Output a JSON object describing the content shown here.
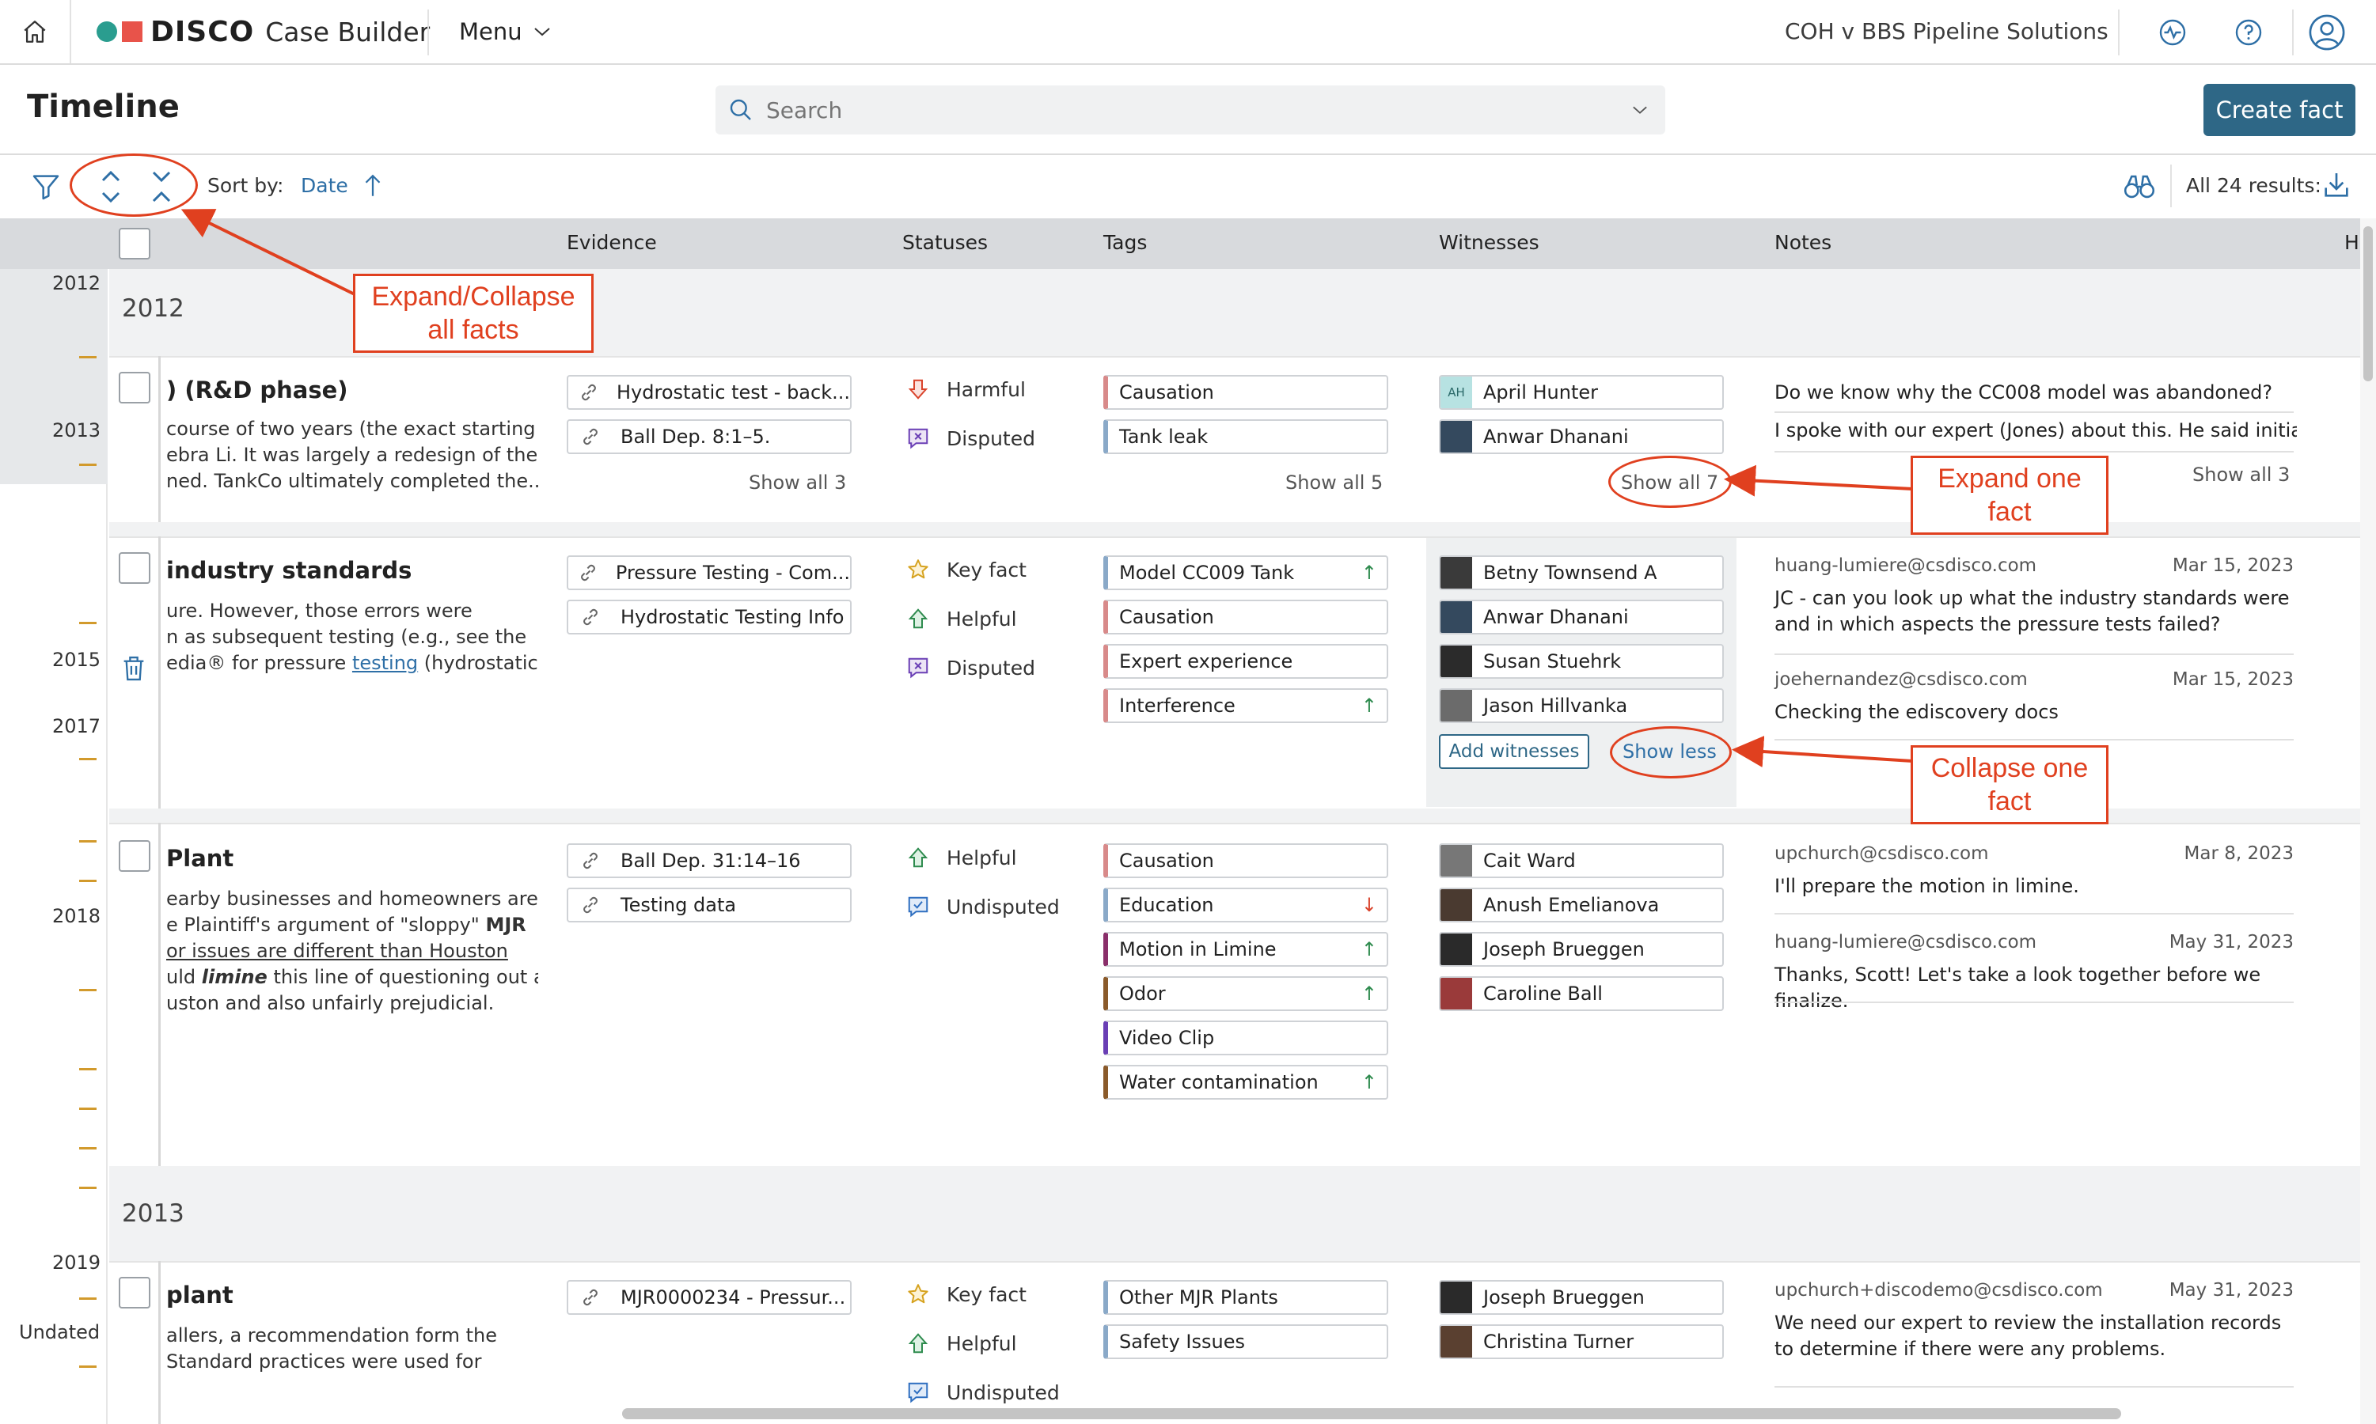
{
  "topbar": {
    "logo_word": "DISCO",
    "logo_sub": "Case Builder",
    "menu_label": "Menu",
    "case_name": "COH v BBS Pipeline Solutions"
  },
  "header": {
    "title": "Timeline",
    "search_placeholder": "Search",
    "create_button": "Create fact"
  },
  "toolbar": {
    "sort_label": "Sort by:",
    "sort_value": "Date",
    "results": "All 24 results:"
  },
  "columns": [
    "Evidence",
    "Statuses",
    "Tags",
    "Witnesses",
    "Notes",
    "H"
  ],
  "rail": {
    "years": [
      "2012",
      "2013",
      "2015",
      "2017",
      "2018",
      "2019",
      "Undated"
    ]
  },
  "year_bands": [
    "2012",
    "2013"
  ],
  "facts": [
    {
      "title": ") (R&D phase)",
      "text": [
        "course of two years (the exact starting",
        "ebra Li.  It was largely a redesign of the",
        "ned.  TankCo ultimately completed the..."
      ],
      "evidence": [
        "Hydrostatic test - back...",
        "Ball Dep. 8:1–5."
      ],
      "evidence_more": "Show all 3",
      "statuses": [
        "Harmful",
        "Disputed"
      ],
      "tags": [
        "Causation",
        "Tank leak"
      ],
      "tags_more": "Show all 5",
      "witnesses": [
        "April Hunter",
        "Anwar Dhanani"
      ],
      "witness_initials": "AH",
      "witnesses_more": "Show all 7",
      "notes": [
        "Do we know why the CC008 model was abandoned?",
        "I spoke with our expert (Jones) about this. He said initial ..."
      ],
      "notes_more": "Show all 3"
    },
    {
      "title": "industry standards",
      "text": [
        "ure.  However, those errors were",
        "n as subsequent testing (e.g., see the",
        "edia® for pressure",
        "testing",
        "(hydrostatic"
      ],
      "evidence": [
        "Pressure Testing - Com...",
        "Hydrostatic Testing Info"
      ],
      "statuses": [
        "Key fact",
        "Helpful",
        "Disputed"
      ],
      "tags": [
        "Model CC009 Tank",
        "Causation",
        "Expert experience",
        "Interference"
      ],
      "witnesses": [
        "Betny Townsend A",
        "Anwar Dhanani",
        "Susan Stuehrk",
        "Jason Hillvanka"
      ],
      "add_witnesses": "Add witnesses",
      "show_less": "Show less",
      "notes": [
        {
          "author": "huang-lumiere@csdisco.com",
          "date": "Mar 15, 2023",
          "body": "JC - can you look up what the industry standards were and in which aspects the pressure tests failed?"
        },
        {
          "author": "joehernandez@csdisco.com",
          "date": "Mar 15, 2023",
          "body": "Checking the ediscovery docs"
        }
      ]
    },
    {
      "title": "Plant",
      "text": [
        "earby businesses and homeowners are",
        "e Plaintiff's argument of \"sloppy\"",
        "MJR",
        "or issues are different than Houston",
        "uld",
        "limine",
        "this line of questioning out as",
        "uston and also unfairly prejudicial."
      ],
      "evidence": [
        "Ball Dep. 31:14–16",
        "Testing data"
      ],
      "statuses": [
        "Helpful",
        "Undisputed"
      ],
      "tags": [
        "Causation",
        "Education",
        "Motion in Limine",
        "Odor",
        "Video Clip",
        "Water contamination"
      ],
      "witnesses": [
        "Cait Ward",
        "Anush Emelianova",
        "Joseph Brueggen",
        "Caroline Ball"
      ],
      "notes": [
        {
          "author": "upchurch@csdisco.com",
          "date": "Mar 8, 2023",
          "body": "I'll prepare the motion in limine."
        },
        {
          "author": "huang-lumiere@csdisco.com",
          "date": "May 31, 2023",
          "body": "Thanks, Scott! Let's take a look together before we finalize."
        }
      ]
    },
    {
      "title": "plant",
      "text": [
        "allers, a recommendation form the",
        "Standard practices were used for"
      ],
      "evidence": [
        "MJR0000234 - Pressur..."
      ],
      "statuses": [
        "Key fact",
        "Helpful",
        "Undisputed"
      ],
      "tags": [
        "Other MJR Plants",
        "Safety Issues"
      ],
      "witnesses": [
        "Joseph Brueggen",
        "Christina Turner"
      ],
      "notes": [
        {
          "author": "upchurch+discodemo@csdisco.com",
          "date": "May 31, 2023",
          "body": "We need our expert to review the installation records to determine if there were any problems."
        }
      ]
    }
  ],
  "annotations": {
    "expand_collapse_all": [
      "Expand/Collapse",
      "all facts"
    ],
    "expand_one": [
      "Expand one",
      "fact"
    ],
    "collapse_one": [
      "Collapse one",
      "fact"
    ]
  },
  "colors": {
    "accent": "#2e6786",
    "annotation": "#e0401f",
    "timeline_tick": "#d29a2c",
    "header_bg": "#d8dadd"
  }
}
